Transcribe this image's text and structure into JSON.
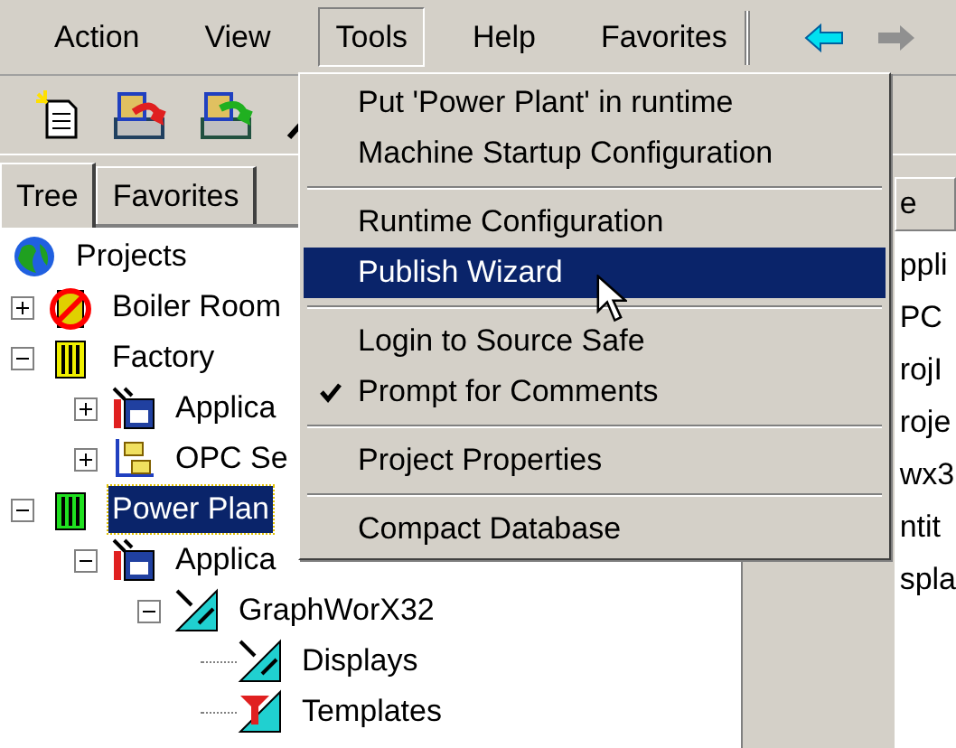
{
  "menu_bar": [
    {
      "label": "Action",
      "selected": false
    },
    {
      "label": "View",
      "selected": false
    },
    {
      "label": "Tools",
      "selected": true
    },
    {
      "label": "Help",
      "selected": false
    },
    {
      "label": "Favorites",
      "selected": false
    }
  ],
  "tabs": [
    {
      "label": "Tree",
      "selected": true
    },
    {
      "label": "Favorites",
      "selected": false
    }
  ],
  "tree": [
    {
      "label": "Projects",
      "kind": "globe",
      "selected": false,
      "children": [
        {
          "label": "Boiler Room",
          "kind": "disabled",
          "expanded": false,
          "selected": false
        },
        {
          "label": "Factory",
          "kind": "plant",
          "expanded": true,
          "selected": false,
          "children": [
            {
              "label": "Applica",
              "kind": "app",
              "expanded": false,
              "selected": false
            },
            {
              "label": "OPC Se",
              "kind": "opc",
              "expanded": false,
              "selected": false
            }
          ]
        },
        {
          "label": "Power Plan",
          "kind": "plant_on",
          "expanded": true,
          "selected": true,
          "children": [
            {
              "label": "Applica",
              "kind": "app",
              "expanded": true,
              "selected": false,
              "children": [
                {
                  "label": "GraphWorX32",
                  "kind": "graphics",
                  "expanded": true,
                  "selected": false,
                  "children": [
                    {
                      "label": "Displays",
                      "kind": "graphics",
                      "selected": false
                    },
                    {
                      "label": "Templates",
                      "kind": "template",
                      "selected": false
                    }
                  ]
                }
              ]
            }
          ]
        }
      ]
    }
  ],
  "list": {
    "column_1": "e",
    "rows": [
      "ppli",
      "PC",
      "rojI",
      "roje",
      "wx3",
      "ntit",
      "spla"
    ]
  },
  "tools_menu": [
    {
      "kind": "item",
      "label": "Put 'Power Plant' in runtime",
      "selected": false,
      "checked": false
    },
    {
      "kind": "item",
      "label": "Machine Startup Configuration",
      "selected": false,
      "checked": false
    },
    {
      "kind": "separator"
    },
    {
      "kind": "item",
      "label": "Runtime Configuration",
      "selected": false,
      "checked": false
    },
    {
      "kind": "item",
      "label": "Publish Wizard",
      "selected": true,
      "checked": false
    },
    {
      "kind": "separator"
    },
    {
      "kind": "item",
      "label": "Login to Source Safe",
      "selected": false,
      "checked": false
    },
    {
      "kind": "item",
      "label": "Prompt for Comments",
      "selected": false,
      "checked": true
    },
    {
      "kind": "separator"
    },
    {
      "kind": "item",
      "label": "Project Properties",
      "selected": false,
      "checked": false
    },
    {
      "kind": "separator"
    },
    {
      "kind": "item",
      "label": "Compact Database",
      "selected": false,
      "checked": false
    }
  ]
}
